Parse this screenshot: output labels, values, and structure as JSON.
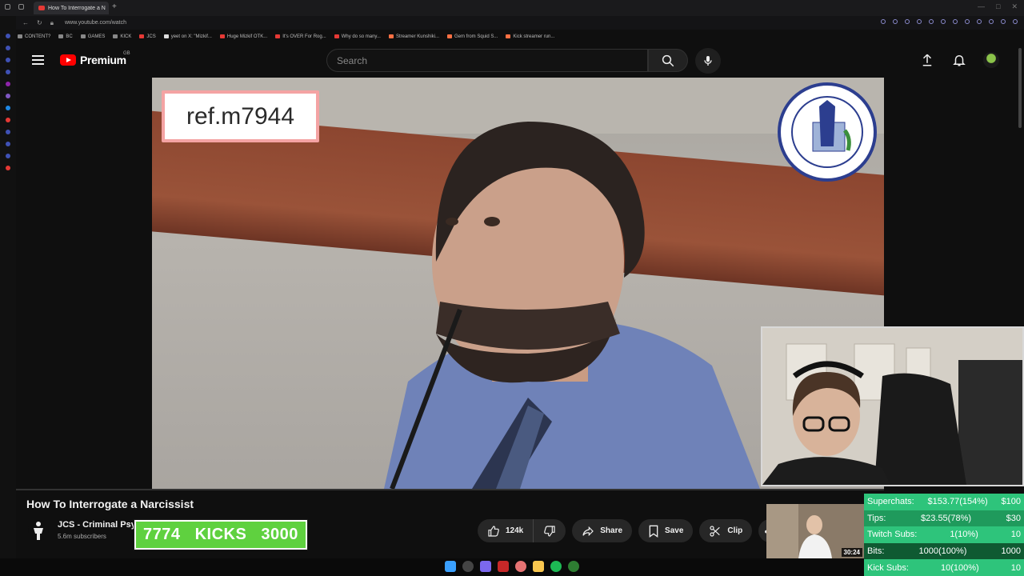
{
  "browser": {
    "tab_title": "How To Interrogate a N",
    "url": "www.youtube.com/watch",
    "bookmarks": [
      {
        "label": "CONTENT?",
        "color": "#888888"
      },
      {
        "label": "BC",
        "color": "#888888"
      },
      {
        "label": "GAMES",
        "color": "#888888"
      },
      {
        "label": "KICK",
        "color": "#888888"
      },
      {
        "label": "JCS",
        "color": "#e53935"
      },
      {
        "label": "yeet on X: \"Mizkif...",
        "color": "#dddddd"
      },
      {
        "label": "Huge Mizkif OTK...",
        "color": "#e53935"
      },
      {
        "label": "It's OVER For Rog...",
        "color": "#e53935"
      },
      {
        "label": "Why do so many...",
        "color": "#e53935"
      },
      {
        "label": "Streamer Kunshiki...",
        "color": "#ff7043"
      },
      {
        "label": "Gem from Squid S...",
        "color": "#ff7043"
      },
      {
        "label": "Kick streamer run...",
        "color": "#ff7043"
      }
    ]
  },
  "header": {
    "logo_text": "Premium",
    "country": "GB",
    "search_placeholder": "Search"
  },
  "video": {
    "ref_code": "ref.m7944",
    "seal_label": "COUNTY OF CHITTENDEN COURTHOUSE",
    "title": "How To Interrogate a Narcissist"
  },
  "channel": {
    "name": "JCS - Criminal Psy",
    "subscribers": "5.6m subscribers"
  },
  "kicks": {
    "current": "7774",
    "label": "KICKS",
    "goal": "3000"
  },
  "actions": {
    "likes": "124k",
    "share": "Share",
    "save": "Save",
    "clip": "Clip",
    "more": "•••"
  },
  "thumbnail": {
    "duration": "30:24"
  },
  "stats": [
    {
      "label": "Superchats:",
      "value": "$153.77(154%)",
      "goal": "$100"
    },
    {
      "label": "Tips:",
      "value": "$23.55(78%)",
      "goal": "$30"
    },
    {
      "label": "Twitch Subs:",
      "value": "1(10%)",
      "goal": "10"
    },
    {
      "label": "Bits:",
      "value": "1000(100%)",
      "goal": "1000"
    },
    {
      "label": "Kick Subs:",
      "value": "10(100%)",
      "goal": "10"
    }
  ],
  "colors": {
    "youtube_red": "#ff0000",
    "kicks_green": "#5fd13f",
    "stats_green": "#2ec47b",
    "ref_border": "#f4a3a3"
  }
}
